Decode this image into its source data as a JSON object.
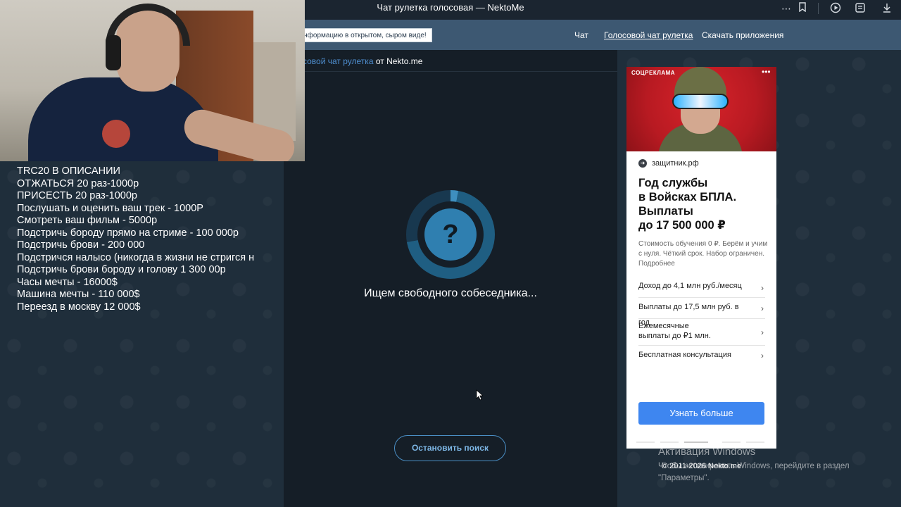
{
  "browser": {
    "title": "Чат рулетка голосовая — NektoMe",
    "icons": [
      "more-icon",
      "bookmark-icon",
      "play-icon",
      "reader-icon",
      "download-icon"
    ]
  },
  "header": {
    "notice": "ть информацию в открытом, сыром виде!",
    "nav": [
      {
        "label": "Чат",
        "active": false
      },
      {
        "label": "Голосовой чат рулетка",
        "active": true
      },
      {
        "label": "Скачать приложения",
        "active": false
      }
    ]
  },
  "stream": {
    "lines": [
      "TRC20 В ОПИСАНИИ",
      "ОТЖАТЬСЯ 20 раз-1000р",
      "ПРИСЕСТЬ 20 раз-1000р",
      "Послушать и оценить ваш трек - 1000Р",
      "Смотреть ваш фильм - 5000р",
      "Подстричь бороду прямо на стриме - 100 000р",
      "Подстричь брови - 200 000",
      "Подстричся налысо (никогда в жизни не стригся н",
      "Подстричь брови бороду и голову 1 300 00р",
      "Часы мечты - 16000$",
      "Машина мечты - 110 000$",
      "Переезд в москву 12 000$"
    ]
  },
  "chat": {
    "breadcrumb_link": "совой чат рулетка",
    "breadcrumb_suffix": " от Nekto.me",
    "status_icon": "?",
    "status": "Ищем свободного собеседника...",
    "stop_button": "Остановить поиск"
  },
  "ad": {
    "label": "СОЦРЕКЛАМА",
    "menu": "•••",
    "domain": "защитник.рф",
    "title_lines": [
      "Год службы",
      "в Войсках БПЛА.",
      "Выплаты",
      "до 17 500 000 ₽"
    ],
    "description": "Стоимость обучения 0 ₽. Берём и учим с нуля. Чёткий срок. Набор ограничен. Подробнее",
    "items": [
      "Доход до 4,1 млн руб./месяц",
      "Выплаты до 17,5 млн руб. в год",
      "Ежемесячные выплаты до ₽1 млн.",
      "Бесплатная консультация"
    ],
    "chevron": "›",
    "cta": "Узнать больше"
  },
  "footer": {
    "windows_title": "Активация Windows",
    "windows_text": "Чтобы активировать Windows, перейдите в раздел \"Параметры\".",
    "copyright": "© 2011-2026 Nekto.me"
  }
}
